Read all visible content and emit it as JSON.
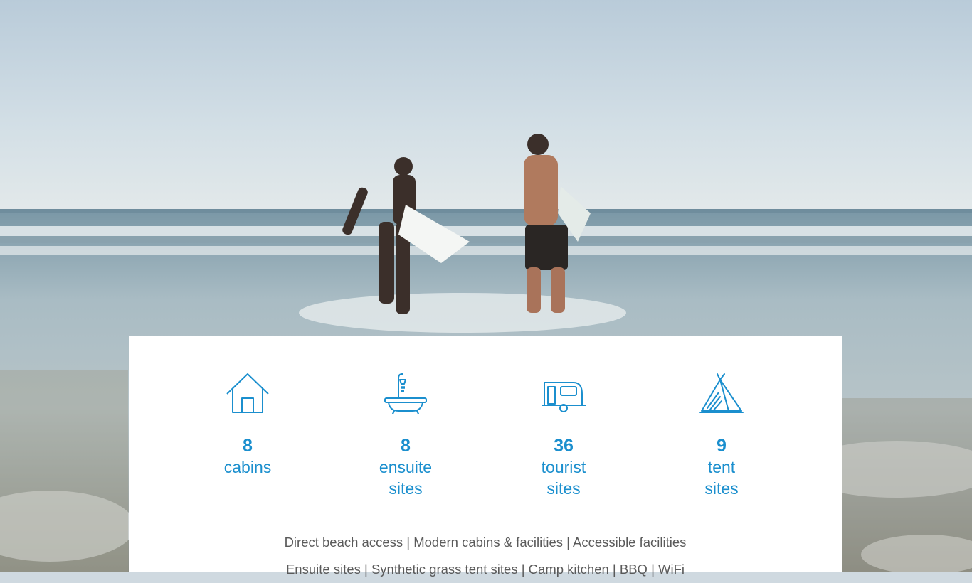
{
  "stats": [
    {
      "icon": "house-icon",
      "number": "8",
      "label": "cabins"
    },
    {
      "icon": "bathtub-shower-icon",
      "number": "8",
      "label": "ensuite\nsites"
    },
    {
      "icon": "caravan-icon",
      "number": "36",
      "label": "tourist\nsites"
    },
    {
      "icon": "tent-icon",
      "number": "9",
      "label": "tent\nsites"
    }
  ],
  "features": {
    "line1": "Direct beach access | Modern cabins & facilities | Accessible facilities",
    "line2": "Ensuite sites | Synthetic grass tent sites | Camp kitchen | BBQ | WiFi"
  },
  "colors": {
    "accent": "#1b8fce",
    "text": "#5a5a5a",
    "card": "#ffffff"
  }
}
